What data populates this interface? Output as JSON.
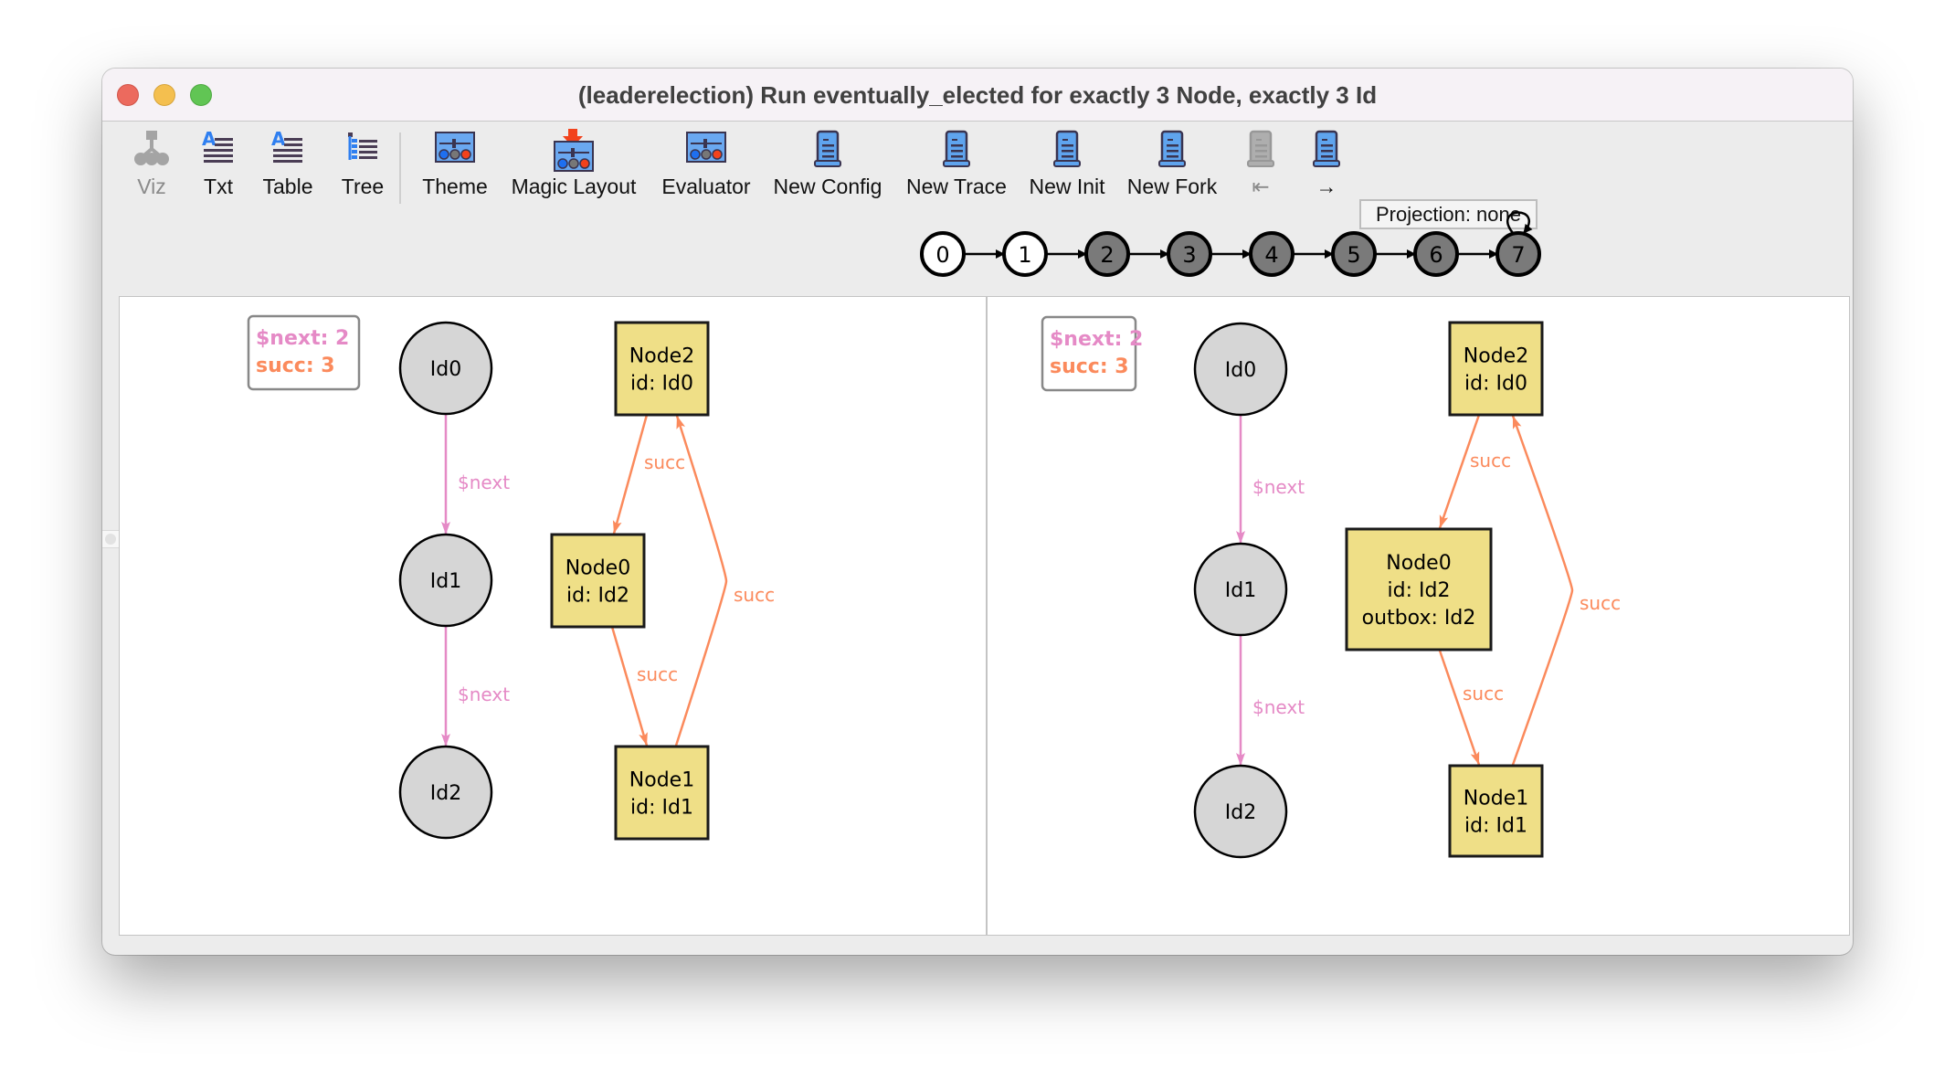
{
  "window": {
    "title": "(leaderelection) Run eventually_elected for exactly 3 Node, exactly 3 Id",
    "controls": [
      "close",
      "minimize",
      "zoom"
    ]
  },
  "toolbar": {
    "items": [
      {
        "label": "Viz",
        "icon": "viz-graph-icon",
        "enabled": false
      },
      {
        "label": "Txt",
        "icon": "text-icon",
        "enabled": true
      },
      {
        "label": "Table",
        "icon": "table-icon",
        "enabled": true
      },
      {
        "label": "Tree",
        "icon": "tree-icon",
        "enabled": true
      },
      {
        "label": "Theme",
        "icon": "theme-icon",
        "enabled": true
      },
      {
        "label": "Magic Layout",
        "icon": "magic-layout-icon",
        "enabled": true
      },
      {
        "label": "Evaluator",
        "icon": "evaluator-icon",
        "enabled": true
      },
      {
        "label": "New Config",
        "icon": "scroll-icon",
        "enabled": true
      },
      {
        "label": "New Trace",
        "icon": "scroll-icon",
        "enabled": true
      },
      {
        "label": "New Init",
        "icon": "scroll-icon",
        "enabled": true
      },
      {
        "label": "New Fork",
        "icon": "scroll-icon",
        "enabled": true
      },
      {
        "label": "⇤",
        "icon": "scroll-icon",
        "enabled": false
      },
      {
        "label": "→",
        "icon": "scroll-icon",
        "enabled": true
      }
    ],
    "projection_label": "Projection: none"
  },
  "trace": {
    "states": [
      "0",
      "1",
      "2",
      "3",
      "4",
      "5",
      "6",
      "7"
    ],
    "current": [
      0,
      1
    ],
    "loop_back_state": 7
  },
  "colors": {
    "next_edge": "#e58ac6",
    "succ_edge": "#fb8a5c",
    "node_fill": "#efdf87",
    "id_fill": "#d6d6d6",
    "state_past": "#ffffff",
    "state_future": "#7a7a7a"
  },
  "panels": [
    {
      "legend": [
        "$next: 2",
        "succ: 3"
      ],
      "ids": [
        "Id0",
        "Id1",
        "Id2"
      ],
      "next_edges": [
        {
          "from": "Id0",
          "to": "Id1",
          "label": "$next"
        },
        {
          "from": "Id1",
          "to": "Id2",
          "label": "$next"
        }
      ],
      "nodes": [
        {
          "name": "Node2",
          "lines": [
            "Node2",
            "id: Id0"
          ]
        },
        {
          "name": "Node0",
          "lines": [
            "Node0",
            "id: Id2"
          ]
        },
        {
          "name": "Node1",
          "lines": [
            "Node1",
            "id: Id1"
          ]
        }
      ],
      "succ_edges": [
        {
          "from": "Node2",
          "to": "Node0",
          "label": "succ"
        },
        {
          "from": "Node0",
          "to": "Node1",
          "label": "succ"
        },
        {
          "from": "Node1",
          "to": "Node2",
          "label": "succ"
        }
      ]
    },
    {
      "legend": [
        "$next: 2",
        "succ: 3"
      ],
      "ids": [
        "Id0",
        "Id1",
        "Id2"
      ],
      "next_edges": [
        {
          "from": "Id0",
          "to": "Id1",
          "label": "$next"
        },
        {
          "from": "Id1",
          "to": "Id2",
          "label": "$next"
        }
      ],
      "nodes": [
        {
          "name": "Node2",
          "lines": [
            "Node2",
            "id: Id0"
          ]
        },
        {
          "name": "Node0",
          "lines": [
            "Node0",
            "id: Id2",
            "outbox: Id2"
          ]
        },
        {
          "name": "Node1",
          "lines": [
            "Node1",
            "id: Id1"
          ]
        }
      ],
      "succ_edges": [
        {
          "from": "Node2",
          "to": "Node0",
          "label": "succ"
        },
        {
          "from": "Node0",
          "to": "Node1",
          "label": "succ"
        },
        {
          "from": "Node1",
          "to": "Node2",
          "label": "succ"
        }
      ]
    }
  ]
}
